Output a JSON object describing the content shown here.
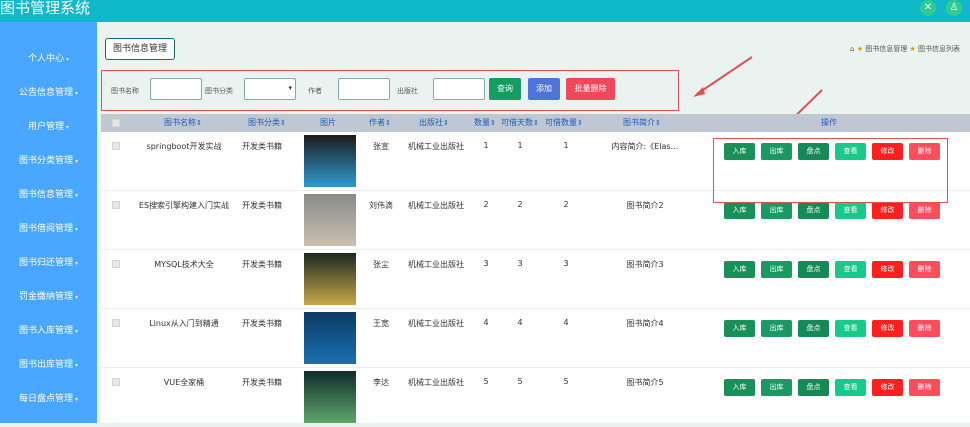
{
  "app": {
    "title": "图书管理系统"
  },
  "topbar": {
    "icons": [
      "expand-icon",
      "user-icon"
    ]
  },
  "sidebar": {
    "items": [
      {
        "label": "个人中心",
        "has_arrow": true
      },
      {
        "label": "公告信息管理",
        "has_arrow": true
      },
      {
        "label": "用户管理",
        "has_arrow": true
      },
      {
        "label": "图书分类管理",
        "has_arrow": true
      },
      {
        "label": "图书信息管理",
        "has_arrow": true
      },
      {
        "label": "图书借阅管理",
        "has_arrow": true
      },
      {
        "label": "图书归还管理",
        "has_arrow": true
      },
      {
        "label": "罚金缴纳管理",
        "has_arrow": true
      },
      {
        "label": "图书入库管理",
        "has_arrow": true
      },
      {
        "label": "图书出库管理",
        "has_arrow": true
      },
      {
        "label": "每日盘点管理",
        "has_arrow": true
      }
    ]
  },
  "tab": {
    "label": "图书信息管理"
  },
  "breadcrumb": {
    "items": [
      "图书信息管理",
      "图书信息列表"
    ]
  },
  "search": {
    "name_label": "图书名称",
    "category_label": "图书分类",
    "author_label": "作者",
    "publisher_label": "出版社",
    "name_value": "",
    "category_value": "",
    "author_value": "",
    "publisher_value": "",
    "query_button": "查询",
    "add_button": "添加",
    "batch_delete_button": "批量删除"
  },
  "table": {
    "headers": {
      "name": "图书名称",
      "category": "图书分类",
      "image": "图片",
      "author": "作者",
      "publisher": "出版社",
      "quantity": "数量",
      "borrow_days": "可借天数",
      "borrow_count": "可借数量",
      "intro": "图书简介",
      "actions": "操作"
    },
    "sort_marker": "⇕",
    "rows": [
      {
        "name": "springboot开发实战",
        "category": "开发类书籍",
        "author": "张宣",
        "publisher": "机械工业出版社",
        "quantity": "1",
        "borrow_days": "1",
        "borrow_count": "1",
        "intro": "内容简介:《Elas…"
      },
      {
        "name": "ES搜索引擎构建入门实战",
        "category": "开发类书籍",
        "author": "刘伟滴",
        "publisher": "机械工业出版社",
        "quantity": "2",
        "borrow_days": "2",
        "borrow_count": "2",
        "intro": "图书简介2"
      },
      {
        "name": "MYSQL技术大全",
        "category": "开发类书籍",
        "author": "张尘",
        "publisher": "机械工业出版社",
        "quantity": "3",
        "borrow_days": "3",
        "borrow_count": "3",
        "intro": "图书简介3"
      },
      {
        "name": "Linux从入门到精通",
        "category": "开发类书籍",
        "author": "王宽",
        "publisher": "机械工业出版社",
        "quantity": "4",
        "borrow_days": "4",
        "borrow_count": "4",
        "intro": "图书简介4"
      },
      {
        "name": "VUE全家桶",
        "category": "开发类书籍",
        "author": "李达",
        "publisher": "机械工业出版社",
        "quantity": "5",
        "borrow_days": "5",
        "borrow_count": "5",
        "intro": "图书简介5"
      }
    ],
    "action_buttons": [
      {
        "key": "in",
        "label": "入库",
        "color": "#17905a"
      },
      {
        "key": "out",
        "label": "出库",
        "color": "#1a9a62"
      },
      {
        "key": "check",
        "label": "盘点",
        "color": "#148a57"
      },
      {
        "key": "view",
        "label": "查看",
        "color": "#17c98a"
      },
      {
        "key": "edit",
        "label": "修改",
        "color": "#ff1f1f"
      },
      {
        "key": "delete",
        "label": "删除",
        "color": "#ff4d5e"
      }
    ]
  },
  "colors": {
    "topbar": "#10b8c8",
    "sidebar": "#4aa7ff",
    "query_button": "#169b63",
    "add_button": "#4f74d9",
    "batch_delete_button": "#f0475a",
    "annotation": "#e05252"
  }
}
